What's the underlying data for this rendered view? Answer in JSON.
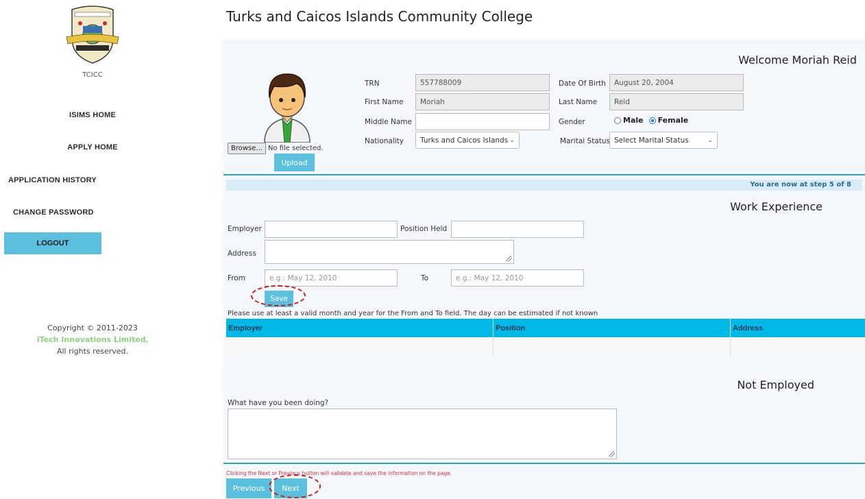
{
  "page": {
    "title": "Turks and Caicos Islands Community College"
  },
  "sidebar": {
    "logo_caption": "TCICC",
    "nav": [
      {
        "label": "ISIMS HOME"
      },
      {
        "label": "APPLY HOME"
      },
      {
        "label": "APPLICATION HISTORY"
      },
      {
        "label": "CHANGE PASSWORD"
      }
    ],
    "logout_label": "LOGOUT",
    "copyright": {
      "line1": "Copyright © 2011-2023",
      "company": "iTech Innovations Limited",
      "company_suffix": ".",
      "line3": "All rights reserved."
    }
  },
  "profile": {
    "welcome": "Welcome Moriah Reid",
    "browse_label": "Browse...",
    "file_status": "No file selected.",
    "upload_label": "Upload",
    "trn_label": "TRN",
    "trn_value": "557788009",
    "first_name_label": "First Name",
    "first_name_value": "Moriah",
    "middle_name_label": "Middle Name",
    "middle_name_value": "",
    "nationality_label": "Nationality",
    "nationality_value": "Turks and Caicos Islands",
    "dob_label": "Date Of Birth",
    "dob_value": "August 20, 2004",
    "last_name_label": "Last Name",
    "last_name_value": "Reid",
    "gender_label": "Gender",
    "gender_options": [
      "Male",
      "Female"
    ],
    "gender_selected": "Female",
    "marital_label": "Marital Status",
    "marital_value": "Select Marital Status"
  },
  "step": {
    "text": "You are now at step 5 of 8"
  },
  "work": {
    "title": "Work Experience",
    "employer_label": "Employer",
    "employer_value": "",
    "position_label": "Position Held",
    "position_value": "",
    "address_label": "Address",
    "address_value": "",
    "from_label": "From",
    "from_placeholder": "e.g.: May 12, 2010",
    "to_label": "To",
    "to_placeholder": "e.g.: May 12, 2010",
    "save_label": "Save",
    "hint": "Please use at least a valid month and year for the From and To field. The day can be estimated if not known",
    "table_headers": [
      "Employer",
      "Position",
      "Address"
    ]
  },
  "not_employed": {
    "title": "Not Employed",
    "question": "What have you been doing?",
    "answer": ""
  },
  "footer": {
    "note": "Clicking the Next or Previous button will validate and save the information on the page.",
    "previous_label": "Previous",
    "next_label": "Next"
  },
  "colors": {
    "accent": "#5bc0de",
    "table_header": "#00b9e6",
    "annotation": "#d01818"
  }
}
